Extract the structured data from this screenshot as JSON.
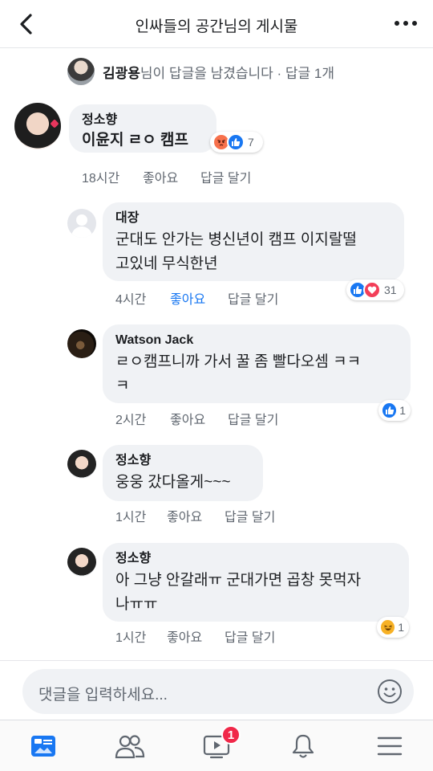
{
  "header": {
    "title": "인싸들의 공간님의 게시물"
  },
  "reply_summary": {
    "author": "김광용",
    "text": "님이 답글을 남겼습니다 · 답글 1개"
  },
  "comments": [
    {
      "name": "정소향",
      "text": "이윤지 ㄹㅇ 캠프",
      "time": "18시간",
      "like_label": "좋아요",
      "reply_label": "답글 달기",
      "reaction_count": "7",
      "reactions": [
        "angry",
        "like"
      ]
    },
    {
      "name": "대장",
      "text_line1": "군대도 안가는 병신년이 캠프 이지랄떨",
      "text_line2": "고있네 무식한년",
      "time": "4시간",
      "like_label": "좋아요",
      "reply_label": "답글 달기",
      "reaction_count": "31",
      "reactions": [
        "like",
        "love"
      ],
      "liked": true
    },
    {
      "name": "Watson Jack",
      "text_line1": "ㄹㅇ캠프니까 가서 꿀 좀 빨다오셈 ㅋㅋ",
      "text_line2": "ㅋ",
      "time": "2시간",
      "like_label": "좋아요",
      "reply_label": "답글 달기",
      "reaction_count": "1",
      "reactions": [
        "like"
      ]
    },
    {
      "name": "정소향",
      "text": "웅웅 갔다올게~~~",
      "time": "1시간",
      "like_label": "좋아요",
      "reply_label": "답글 달기"
    },
    {
      "name": "정소향",
      "text_line1": "아 그냥 안갈래ㅠ 군대가면 곱창 못먹자",
      "text_line2": "나ㅠㅠ",
      "time": "1시간",
      "like_label": "좋아요",
      "reply_label": "답글 달기",
      "reaction_count": "1",
      "reactions": [
        "haha"
      ]
    }
  ],
  "composer": {
    "placeholder": "댓글을 입력하세요..."
  },
  "nav": {
    "items": [
      "news-feed",
      "friends",
      "watch",
      "notifications",
      "menu"
    ],
    "watch_badge": "1"
  },
  "colors": {
    "accent": "#1877f2",
    "bubble": "#f0f2f5",
    "badge": "#f02849"
  }
}
